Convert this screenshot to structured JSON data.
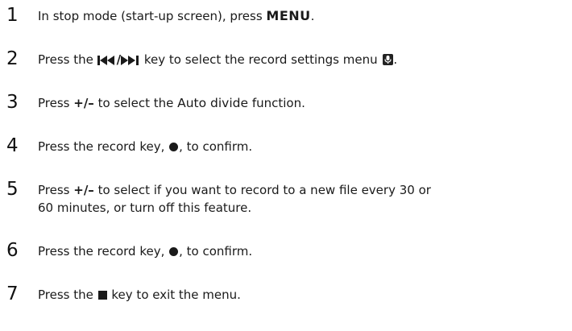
{
  "steps": [
    {
      "number": "1",
      "parts": [
        "In stop mode (start-up screen), press ",
        "MENU",
        "."
      ]
    },
    {
      "number": "2",
      "parts": [
        "Press the ",
        "/",
        " key to select the record settings menu ",
        "."
      ]
    },
    {
      "number": "3",
      "parts": [
        "Press ",
        "+/–",
        " to select the ",
        "Auto divide",
        " function."
      ]
    },
    {
      "number": "4",
      "parts": [
        "Press the record key, ",
        ", to confirm."
      ]
    },
    {
      "number": "5",
      "parts": [
        "Press ",
        "+/–",
        " to select if you want to record to a new file every 30 or",
        "60 minutes, or turn off this feature."
      ]
    },
    {
      "number": "6",
      "parts": [
        "Press the record key, ",
        ", to confirm."
      ]
    },
    {
      "number": "7",
      "parts": [
        "Press the ",
        " key to exit the menu."
      ]
    }
  ],
  "icons": {
    "prev": "skip-back-icon",
    "next": "skip-forward-icon",
    "record_menu": "microphone-menu-icon",
    "record": "record-dot-icon",
    "stop": "stop-square-icon"
  }
}
